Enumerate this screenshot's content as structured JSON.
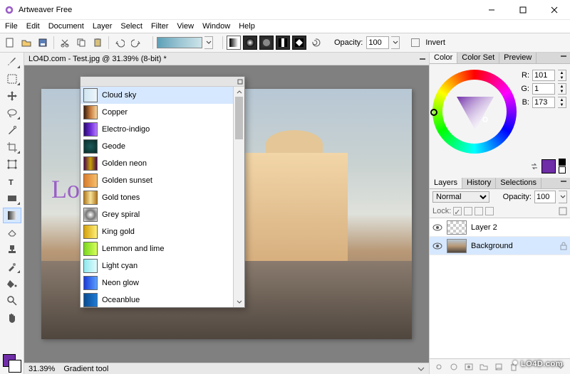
{
  "app": {
    "title": "Artweaver Free"
  },
  "menu": [
    "File",
    "Edit",
    "Document",
    "Layer",
    "Select",
    "Filter",
    "View",
    "Window",
    "Help"
  ],
  "toolbar": {
    "opacity_label": "Opacity:",
    "opacity_value": "100",
    "invert_label": "Invert"
  },
  "document": {
    "tab_title": "LO4D.com - Test.jpg @ 31.39% (8-bit) *",
    "zoom": "31.39%",
    "tool_status": "Gradient tool"
  },
  "gradient_list": [
    {
      "name": "Cloud sky",
      "sel": true,
      "sw": "linear-gradient(90deg,#cfe5f2,#eef6fb)"
    },
    {
      "name": "Copper",
      "sw": "linear-gradient(90deg,#3a1d0d,#c77b3c,#f7d7a0)"
    },
    {
      "name": "Electro-indigo",
      "sw": "linear-gradient(90deg,#2a0a6e,#6b2bd6,#b77bff)"
    },
    {
      "name": "Geode",
      "sw": "radial-gradient(circle,#1a5c5a,#0a2a28)"
    },
    {
      "name": "Golden neon",
      "sw": "linear-gradient(90deg,#4a0a42,#c9a10a,#4a0a42)"
    },
    {
      "name": "Golden sunset",
      "sw": "linear-gradient(90deg,#d97b2a,#f7c06b)"
    },
    {
      "name": "Gold tones",
      "sw": "linear-gradient(90deg,#b57a1e,#f5e39a,#b57a1e)"
    },
    {
      "name": "Grey spiral",
      "sw": "radial-gradient(circle,#fff,#777,#eee)"
    },
    {
      "name": "King gold",
      "sw": "linear-gradient(90deg,#d4a10a,#fff07a)"
    },
    {
      "name": "Lemmon and lime",
      "sw": "linear-gradient(90deg,#7ad61e,#d8ff5a)"
    },
    {
      "name": "Light cyan",
      "sw": "linear-gradient(90deg,#8fe9ee,#e1fbfc)"
    },
    {
      "name": "Neon glow",
      "sw": "linear-gradient(90deg,#1a3bd6,#5aa0ff)"
    },
    {
      "name": "Oceanblue",
      "sw": "linear-gradient(90deg,#0a4a8f,#1e7bd6)"
    }
  ],
  "color_panel": {
    "tabs": [
      "Color",
      "Color Set",
      "Preview"
    ],
    "r": "101",
    "g": "1",
    "b": "173",
    "swatch_hex": "#6f2da8"
  },
  "layers_panel": {
    "tabs": [
      "Layers",
      "History",
      "Selections"
    ],
    "blend_mode": "Normal",
    "opacity_label": "Opacity:",
    "opacity_value": "100",
    "lock_label": "Lock:",
    "layers": [
      {
        "name": "Layer 2",
        "visible": true,
        "sel": false,
        "thumb": "checker"
      },
      {
        "name": "Background",
        "visible": true,
        "sel": true,
        "thumb": "photo",
        "locked": true
      }
    ]
  },
  "watermark": "LO4D.com"
}
